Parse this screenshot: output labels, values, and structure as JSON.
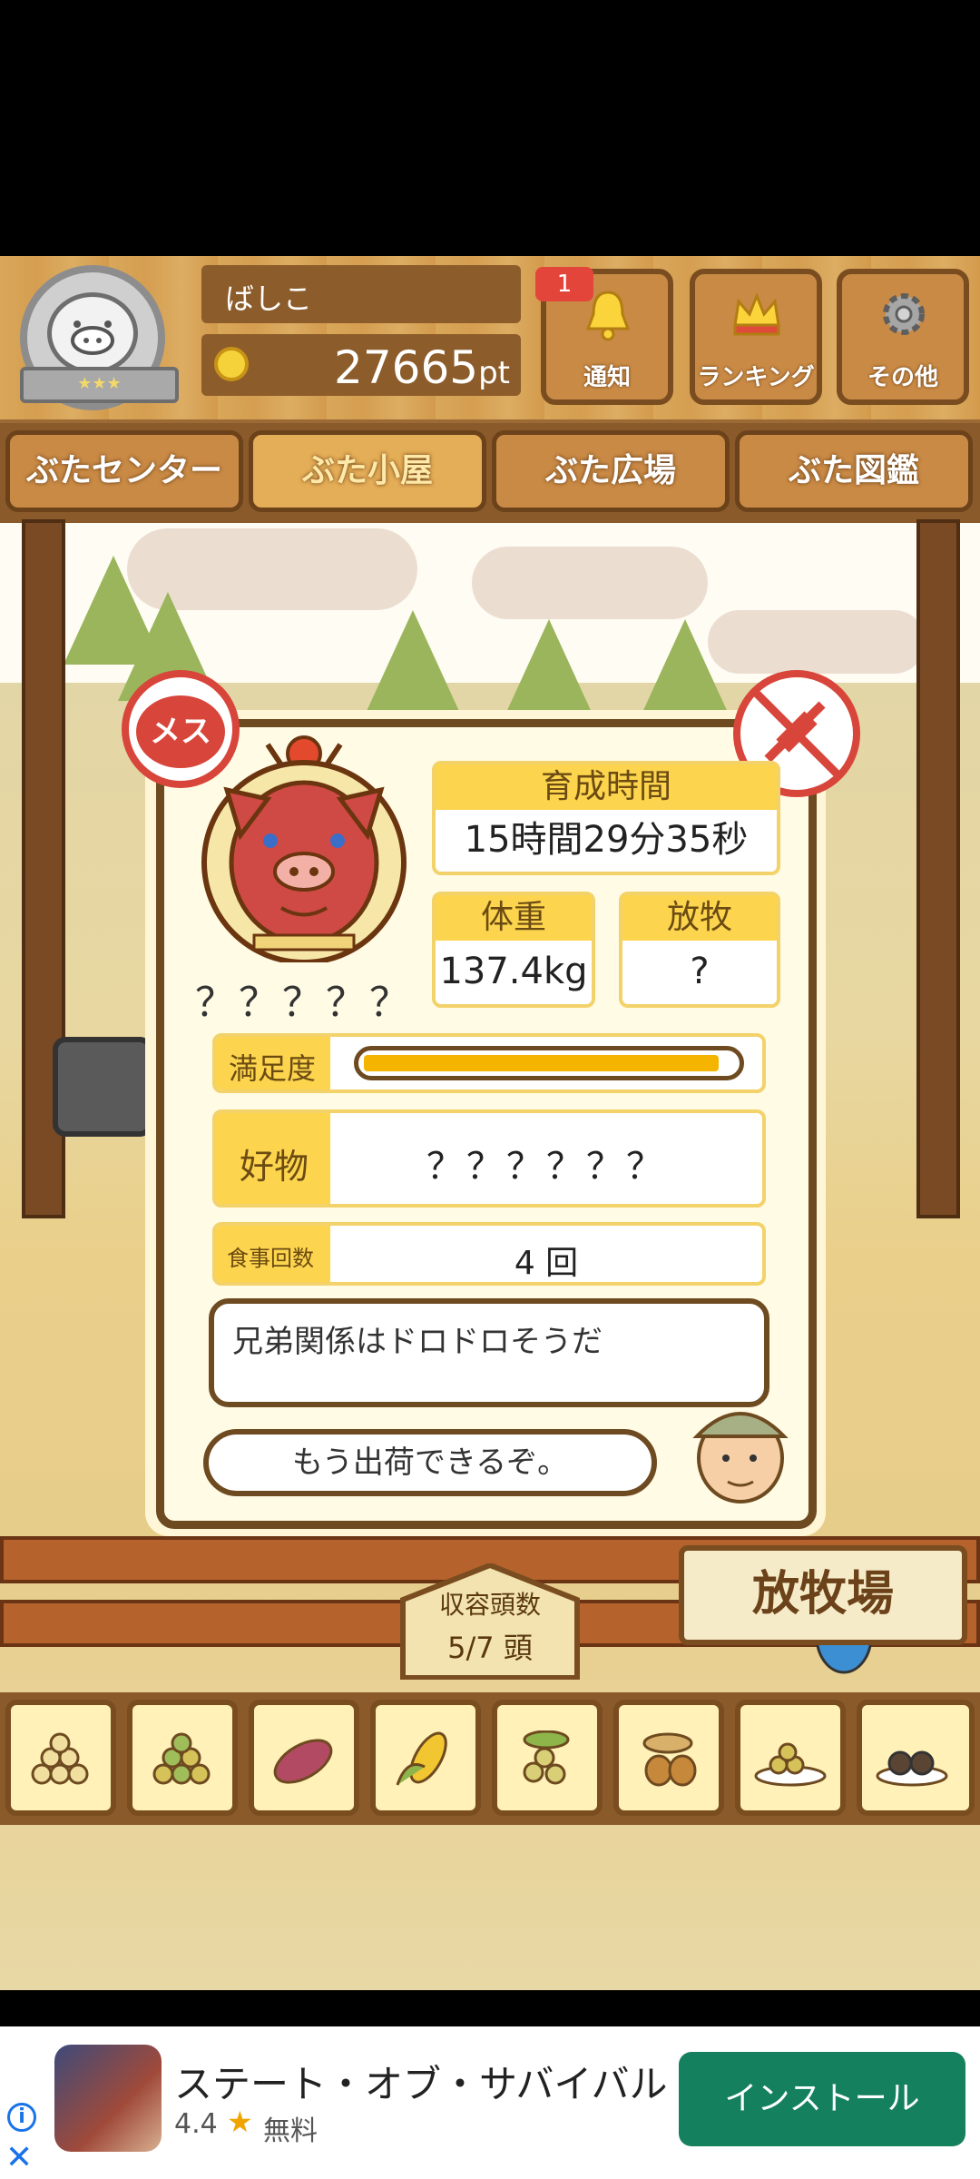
{
  "header": {
    "player_name": "ばしこ",
    "points": "27665",
    "points_unit": "pt",
    "notification_count": "1",
    "buttons": {
      "notify": "通知",
      "ranking": "ランキング",
      "other": "その他"
    }
  },
  "nav": {
    "tabs": [
      "ぶたセンター",
      "ぶた小屋",
      "ぶた広場",
      "ぶた図鑑"
    ],
    "active_index": 1
  },
  "pig": {
    "gender_badge": "メス",
    "name_unknown": "？？？？？",
    "raise_time_label": "育成時間",
    "raise_time": "15時間29分35秒",
    "weight_label": "体重",
    "weight": "137.4kg",
    "grazing_label": "放牧",
    "grazing": "?",
    "satisfaction_label": "満足度",
    "satisfaction": 0.97,
    "favorite_label": "好物",
    "favorite": "？？？？？？",
    "meals_label": "食事回数",
    "meals": "4 回",
    "comment": "兄弟関係はドロドロそうだ",
    "farmer_comment": "もう出荷できるぞ。"
  },
  "capacity": {
    "label": "収容頭数",
    "value": "5/7 頭"
  },
  "pasture_sign": "放牧場",
  "feed_items": [
    "feed-1",
    "feed-2",
    "sweet-potato",
    "corn",
    "beans",
    "acorn",
    "grain-plate",
    "meatball-plate"
  ],
  "ad": {
    "title": "ステート・オブ・サバイバル",
    "rating": "4.4",
    "price": "無料",
    "install_label": "インストール",
    "info_icon": "i",
    "close_icon": "✕"
  },
  "colors": {
    "wood": "#c98a45",
    "dark_wood": "#7a4d20",
    "gold": "#fcd44e",
    "install_green": "#14805e"
  }
}
